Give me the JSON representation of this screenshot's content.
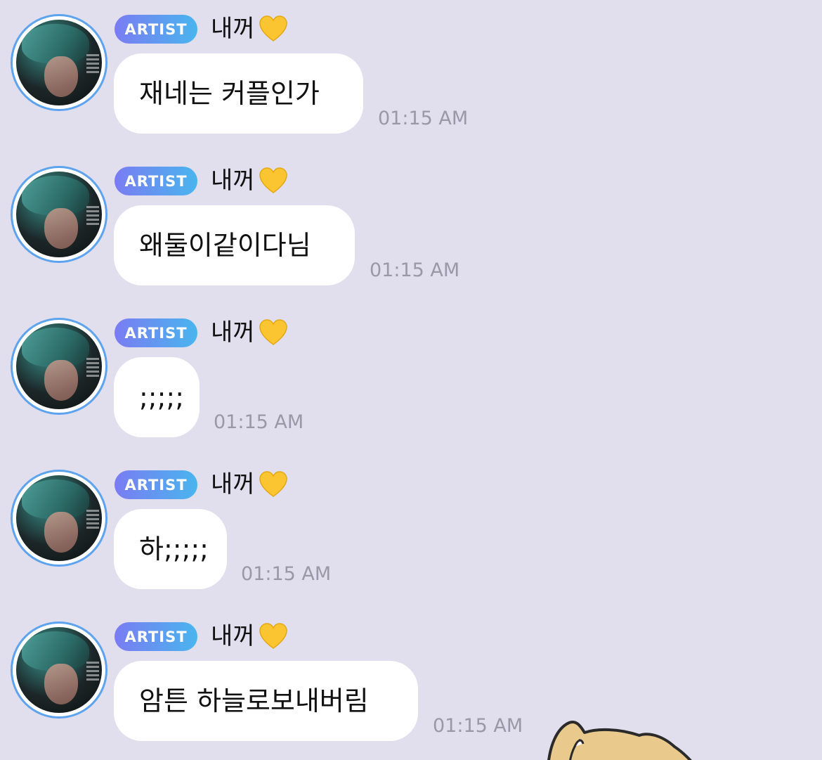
{
  "messages": [
    {
      "badge": "ARTIST",
      "name": "내꺼",
      "heart": "yellow-heart-icon",
      "text": "재네는 커플인가",
      "time": "01:15 AM"
    },
    {
      "badge": "ARTIST",
      "name": "내꺼",
      "heart": "yellow-heart-icon",
      "text": "왜둘이같이다님",
      "time": "01:15 AM"
    },
    {
      "badge": "ARTIST",
      "name": "내꺼",
      "heart": "yellow-heart-icon",
      "text": ";;;;;",
      "time": "01:15 AM"
    },
    {
      "badge": "ARTIST",
      "name": "내꺼",
      "heart": "yellow-heart-icon",
      "text": "하;;;;;",
      "time": "01:15 AM"
    },
    {
      "badge": "ARTIST",
      "name": "내꺼",
      "heart": "yellow-heart-icon",
      "text": "암튼 하늘로보내버림",
      "time": "01:15 AM"
    }
  ],
  "colors": {
    "background": "#e1dfee",
    "bubble": "#ffffff",
    "badge_start": "#7a7cf2",
    "badge_end": "#49b5ee",
    "avatar_ring": "#5ea3ee",
    "heart": "#fbc531",
    "timestamp": "#9a98a6"
  }
}
